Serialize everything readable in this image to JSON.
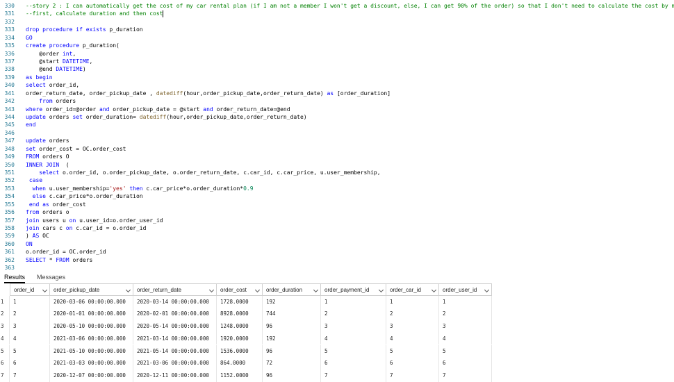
{
  "editor": {
    "lines": [
      {
        "num": "330",
        "html": "<span class=\"cm\">--story 2 : I can automatically get the cost of my car rental plan (if I am not a member I won't get a discount, else, I can get 90% of the order) so that I don't need to calculate the cost by myself.</span>"
      },
      {
        "num": "331",
        "html": "<span class=\"cm\">--first, calculate duration and then cost</span><span class=\"cursor\" data-name=\"text-cursor\"></span>"
      },
      {
        "num": "332",
        "html": ""
      },
      {
        "num": "333",
        "html": "<span class=\"kw\">drop procedure if exists</span> p_duration"
      },
      {
        "num": "334",
        "html": "<span class=\"kw\">GO</span>"
      },
      {
        "num": "335",
        "html": "<span class=\"kw\">create procedure</span> p_duration("
      },
      {
        "num": "336",
        "html": "    @order <span class=\"kw\">int</span>,"
      },
      {
        "num": "337",
        "html": "    @start <span class=\"kw\">DATETIME</span>,"
      },
      {
        "num": "338",
        "html": "    @end <span class=\"kw\">DATETIME</span>)"
      },
      {
        "num": "339",
        "html": "<span class=\"kw\">as begin</span>"
      },
      {
        "num": "340",
        "html": "<span class=\"kw\">select</span> order_id,"
      },
      {
        "num": "341",
        "html": "order_return_date, order_pickup_date , <span class=\"fn\">datediff</span>(hour,order_pickup_date,order_return_date) <span class=\"kw\">as</span> [order_duration]"
      },
      {
        "num": "342",
        "html": "    <span class=\"kw\">from</span> orders"
      },
      {
        "num": "343",
        "html": "<span class=\"kw\">where</span> order_id=@order <span class=\"kw\">and</span> order_pickup_date = @start <span class=\"kw\">and</span> order_return_date=@end"
      },
      {
        "num": "344",
        "html": "<span class=\"kw\">update</span> orders <span class=\"kw\">set</span> order_duration= <span class=\"fn\">datediff</span>(hour,order_pickup_date,order_return_date)"
      },
      {
        "num": "345",
        "html": "<span class=\"kw\">end</span>"
      },
      {
        "num": "346",
        "html": ""
      },
      {
        "num": "347",
        "html": "<span class=\"kw\">update</span> orders"
      },
      {
        "num": "348",
        "html": "<span class=\"kw\">set</span> order_cost = OC.order_cost"
      },
      {
        "num": "349",
        "html": "<span class=\"kw\">FROM</span> orders O"
      },
      {
        "num": "350",
        "html": "<span class=\"kw\">INNER JOIN</span>  ("
      },
      {
        "num": "351",
        "html": "    <span class=\"kw\">select</span> o.order_id, o.order_pickup_date, o.order_return_date, c.car_id, c.car_price, u.user_membership,"
      },
      {
        "num": "352",
        "html": " <span class=\"kw\">case</span>"
      },
      {
        "num": "353",
        "html": "  <span class=\"kw\">when</span> u.user_membership=<span class=\"st\">'yes'</span> <span class=\"kw\">then</span> c.car_price*o.order_duration*<span class=\"nm\">0.9</span>"
      },
      {
        "num": "354",
        "html": "  <span class=\"kw\">else</span> c.car_price*o.order_duration"
      },
      {
        "num": "355",
        "html": " <span class=\"kw\">end as</span> order_cost"
      },
      {
        "num": "356",
        "html": "<span class=\"kw\">from</span> orders o"
      },
      {
        "num": "357",
        "html": "<span class=\"kw\">join</span> users u <span class=\"kw\">on</span> u.user_id=o.order_user_id"
      },
      {
        "num": "358",
        "html": "<span class=\"kw\">join</span> cars c <span class=\"kw\">on</span> c.car_id = o.order_id"
      },
      {
        "num": "359",
        "html": ") <span class=\"kw\">AS</span> OC"
      },
      {
        "num": "360",
        "html": "<span class=\"kw\">ON</span>"
      },
      {
        "num": "361",
        "html": "o.order_id = OC.order_id"
      },
      {
        "num": "362",
        "html": "<span class=\"kw\">SELECT</span> * <span class=\"kw\">FROM</span> orders"
      },
      {
        "num": "363",
        "html": ""
      }
    ]
  },
  "tabs": {
    "results": "Results",
    "messages": "Messages"
  },
  "grid": {
    "columns": [
      "order_id",
      "order_pickup_date",
      "order_return_date",
      "order_cost",
      "order_duration",
      "order_payment_id",
      "order_car_id",
      "order_user_id"
    ],
    "rows": [
      {
        "n": "1",
        "cells": [
          "1",
          "2020-03-06 00:00:00.000",
          "2020-03-14 00:00:00.000",
          "1728.0000",
          "192",
          "1",
          "1",
          "1"
        ]
      },
      {
        "n": "2",
        "cells": [
          "2",
          "2020-01-01 00:00:00.000",
          "2020-02-01 00:00:00.000",
          "8928.0000",
          "744",
          "2",
          "2",
          "2"
        ]
      },
      {
        "n": "3",
        "cells": [
          "3",
          "2020-05-10 00:00:00.000",
          "2020-05-14 00:00:00.000",
          "1248.0000",
          "96",
          "3",
          "3",
          "3"
        ]
      },
      {
        "n": "4",
        "cells": [
          "4",
          "2021-03-06 00:00:00.000",
          "2021-03-14 00:00:00.000",
          "1920.0000",
          "192",
          "4",
          "4",
          "4"
        ]
      },
      {
        "n": "5",
        "cells": [
          "5",
          "2021-05-10 00:00:00.000",
          "2021-05-14 00:00:00.000",
          "1536.0000",
          "96",
          "5",
          "5",
          "5"
        ]
      },
      {
        "n": "6",
        "cells": [
          "6",
          "2021-03-03 00:00:00.000",
          "2021-03-06 00:00:00.000",
          "864.0000",
          "72",
          "6",
          "6",
          "6"
        ]
      },
      {
        "n": "7",
        "cells": [
          "7",
          "2020-12-07 00:00:00.000",
          "2020-12-11 00:00:00.000",
          "1152.0000",
          "96",
          "7",
          "7",
          "7"
        ]
      }
    ]
  }
}
